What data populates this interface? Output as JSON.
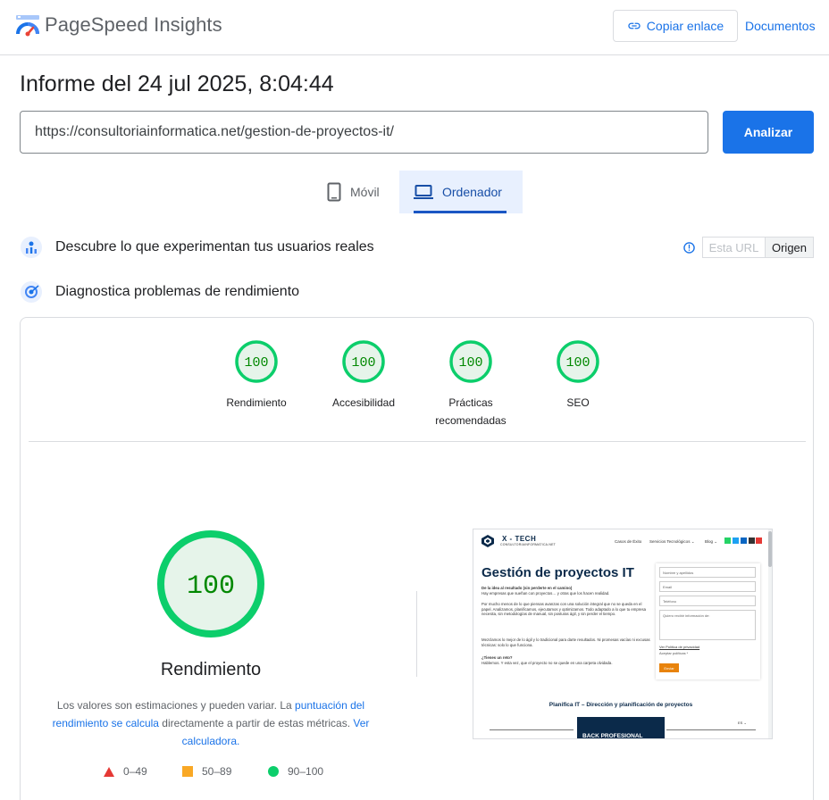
{
  "header": {
    "app_title": "PageSpeed Insights",
    "copy_link_label": "Copiar enlace",
    "docs_label": "Documentos"
  },
  "report": {
    "title": "Informe del 24 jul 2025, 8:04:44",
    "url_value": "https://consultoriainformatica.net/gestion-de-proyectos-it/",
    "analyze_label": "Analizar"
  },
  "tabs": [
    {
      "label": "Móvil",
      "icon": "mobile-icon",
      "selected": false
    },
    {
      "label": "Ordenador",
      "icon": "laptop-icon",
      "selected": true
    }
  ],
  "field_section": {
    "title": "Descubre lo que experimentan tus usuarios reales",
    "toggle_url": "Esta URL",
    "toggle_origin": "Origen"
  },
  "diag_section": {
    "title": "Diagnostica problemas de rendimiento"
  },
  "scores": [
    {
      "value": "100",
      "label": "Rendimiento"
    },
    {
      "value": "100",
      "label": "Accesibilidad"
    },
    {
      "value": "100",
      "label_line1": "Prácticas",
      "label_line2": "recomendadas"
    },
    {
      "value": "100",
      "label": "SEO"
    }
  ],
  "performance": {
    "score": "100",
    "score_fraction": 1.0,
    "label": "Rendimiento",
    "disclaimer_pre": "Los valores son estimaciones y pueden variar. La ",
    "disclaimer_link1": "puntuación del rendimiento se calcula",
    "disclaimer_mid": " directamente a partir de estas métricas. ",
    "disclaimer_link2": "Ver calculadora."
  },
  "legend": [
    {
      "range": "0–49",
      "color": "#e53935",
      "shape": "triangle"
    },
    {
      "range": "50–89",
      "color": "#f9a825",
      "shape": "square"
    },
    {
      "range": "90–100",
      "color": "#0cce6b",
      "shape": "circle"
    }
  ],
  "colors": {
    "accent": "#1a73e8",
    "pass_green": "#0cce6b",
    "pass_text": "#008800",
    "pass_fill": "#e6f4ea"
  },
  "screenshot": {
    "brand": "X - TECH",
    "brand_sub": "CONSULTORIAINFORMATICA.NET",
    "nav": [
      "Casos de Éxito",
      "Servicios Tecnológicos ⌄",
      "Blog ⌄"
    ],
    "heading": "Gestión de proyectos IT",
    "para1_bold": "De la idea al resultado (sin perderte en el camino)",
    "para1": "Hay empresas que sueñan con proyectos… y otras que los hacen realidad.",
    "para2": "Por mucho menos de lo que piensas avanzas con una solución integral que no se queda en el papel. Analizamos, planificamos, ejecutamos y optimizamos. Todo adaptado a lo que tu empresa necesita, sin metodologías de manual, sin posturas ágil, y sin perder el tiempo.",
    "para3": "Mezclamos lo mejor de lo ágil y lo tradicional para darte resultados. Ni promesas vacías ni excusas técnicas: solo lo que funciona.",
    "para4_bold": "¿Tienes un reto?",
    "para4": "Hablemos. Y esta vez, que el proyecto no se quede en una carpeta olvidada.",
    "form_fields": [
      "Nombre y apellidos",
      "Email",
      "Teléfono",
      "Quiero recibir información de:"
    ],
    "privacy_link": "Ver Política de privacidad",
    "accept_label": "Aceptar políticas *",
    "send_label": "Enviar",
    "subheading": "Planifica IT – Dirección y planificación de proyectos",
    "banner_text": "BACK PROFESIONAL",
    "lang": "ES ⌄"
  }
}
